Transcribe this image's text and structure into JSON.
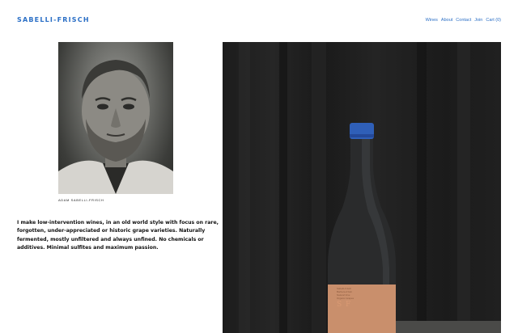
{
  "header": {
    "brand": "SABELLI-FRISCH",
    "nav": [
      "Wines",
      "About",
      "Contact",
      "Join",
      "Cart (0)"
    ]
  },
  "portrait": {
    "caption": "ADAM SABELLI-FRISCH"
  },
  "bio": {
    "text": "I make low-intervention wines, in an old world style with focus on rare, forgotten, under-appreciated or historic grape varieties. Naturally fermented, mostly unfiltered and always unfined. No chemicals or additives. Minimal sulfites and maximum passion."
  },
  "bottle": {
    "label_lines": [
      "Sabelli-Frisch",
      "Barbera d'Asti",
      "Natural Vine",
      "Organic Grapes"
    ],
    "label_brand": "S F"
  },
  "colors": {
    "accent": "#2b6fc6",
    "capsule": "#2f5fb8",
    "label": "#c98f6c"
  }
}
